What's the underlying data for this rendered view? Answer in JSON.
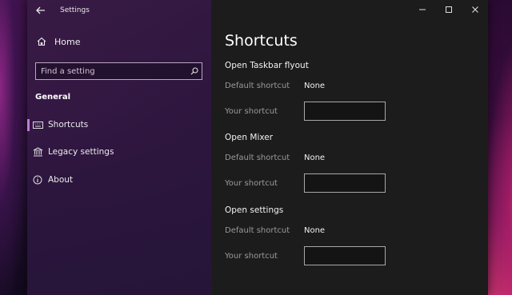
{
  "window": {
    "title": "Settings"
  },
  "sidebar": {
    "home_label": "Home",
    "search": {
      "placeholder": "Find a setting",
      "icon": "search-icon"
    },
    "section_label": "General",
    "items": [
      {
        "label": "Shortcuts",
        "icon": "keyboard-icon",
        "selected": true
      },
      {
        "label": "Legacy settings",
        "icon": "bank-icon",
        "selected": false
      },
      {
        "label": "About",
        "icon": "info-icon",
        "selected": false
      }
    ]
  },
  "main": {
    "page_title": "Shortcuts",
    "groups": [
      {
        "title": "Open Taskbar flyout",
        "default_label": "Default shortcut",
        "default_value": "None",
        "your_label": "Your shortcut",
        "your_value": ""
      },
      {
        "title": "Open Mixer",
        "default_label": "Default shortcut",
        "default_value": "None",
        "your_label": "Your shortcut",
        "your_value": ""
      },
      {
        "title": "Open settings",
        "default_label": "Default shortcut",
        "default_value": "None",
        "your_label": "Your shortcut",
        "your_value": ""
      }
    ]
  },
  "colors": {
    "accent": "#c07ad8",
    "main_bg": "#1c1c1c"
  }
}
